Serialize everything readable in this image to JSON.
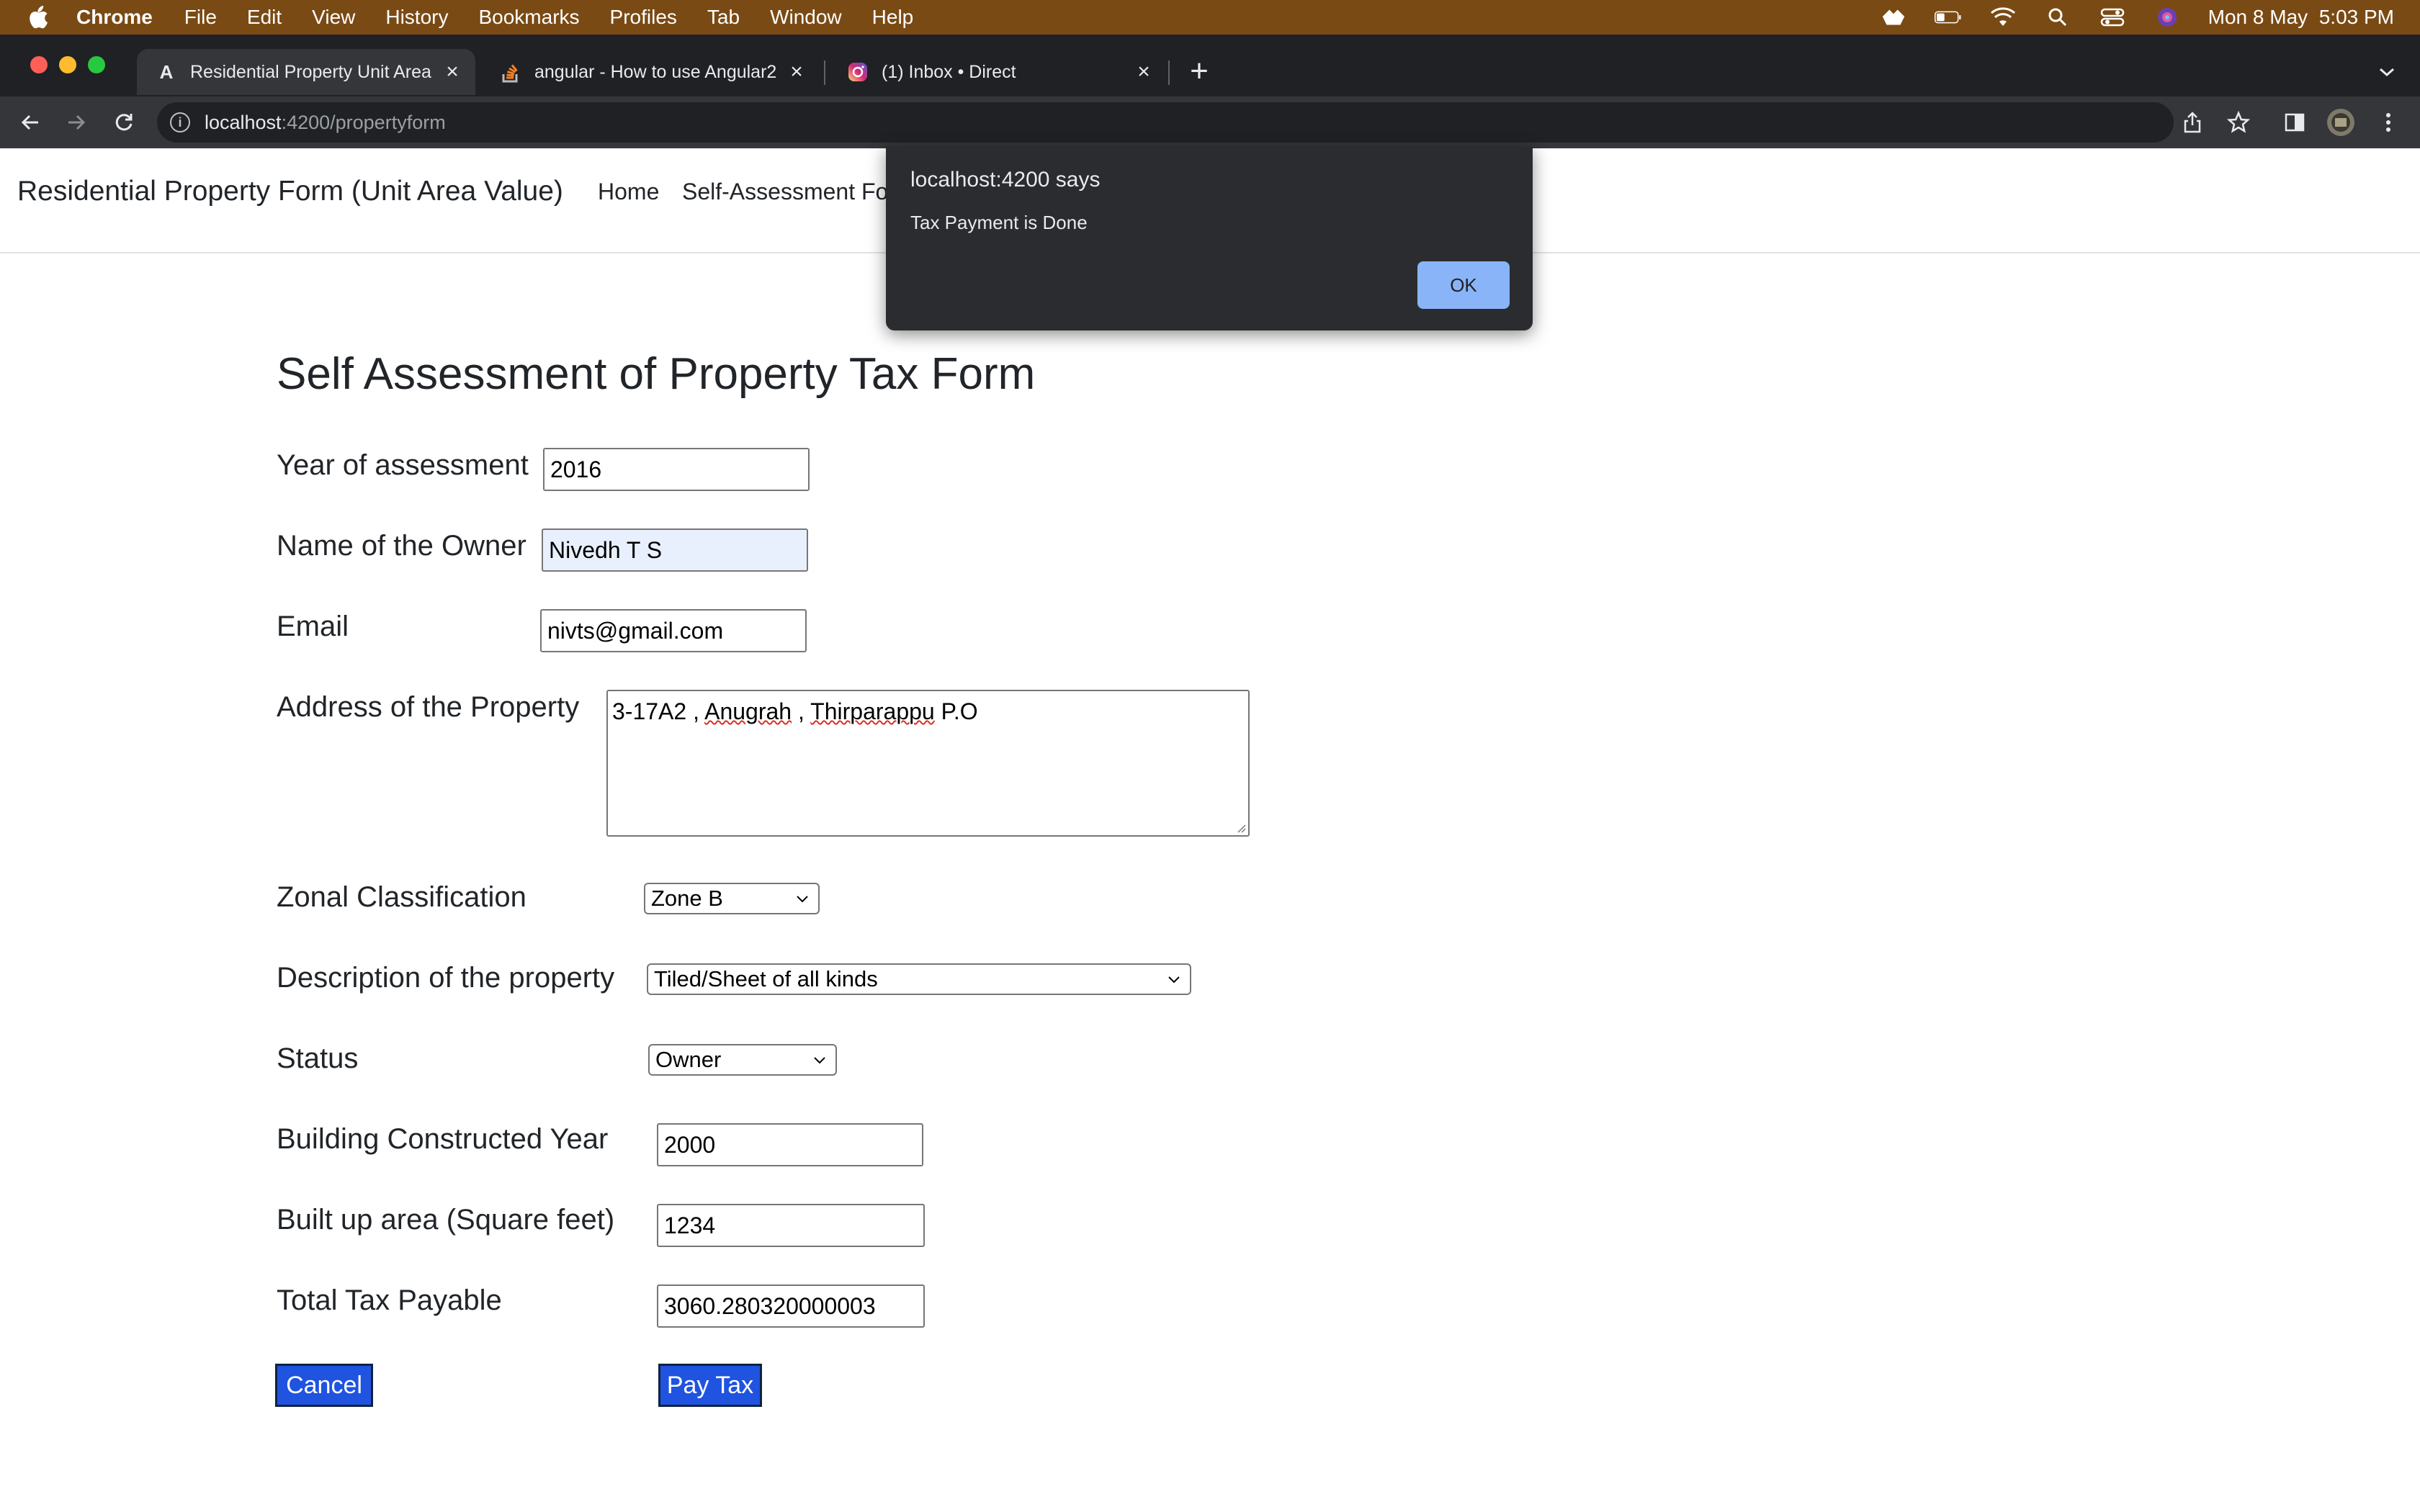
{
  "menubar": {
    "app_name": "Chrome",
    "items": [
      "File",
      "Edit",
      "View",
      "History",
      "Bookmarks",
      "Profiles",
      "Tab",
      "Window",
      "Help"
    ],
    "clock": "Mon 8 May  5:03 PM"
  },
  "tabs": [
    {
      "title": "Residential Property Unit Area",
      "favicon": "A"
    },
    {
      "title": "angular - How to use Angular2",
      "favicon": "stackoverflow-icon"
    },
    {
      "title": "(1) Inbox • Direct",
      "favicon": "instagram-icon"
    }
  ],
  "address_bar": {
    "host": "localhost",
    "path": ":4200/propertyform"
  },
  "navbar": {
    "brand": "Residential Property Form (Unit Area Value)",
    "links": [
      "Home",
      "Self-Assessment Fo"
    ]
  },
  "form": {
    "title": "Self Assessment of Property Tax Form",
    "year_label": "Year of assessment",
    "year_value": "2016",
    "owner_label": "Name of the Owner",
    "owner_value": "Nivedh T S",
    "email_label": "Email",
    "email_value": "nivts@gmail.com",
    "address_label": "Address of the Property",
    "address_parts": [
      "3-17A2 , ",
      "Anugrah",
      " , ",
      "Thirparappu",
      " P.O"
    ],
    "zone_label": "Zonal Classification",
    "zone_value": "Zone B",
    "description_label": "Description of the property",
    "description_value": "Tiled/Sheet of all kinds",
    "status_label": "Status",
    "status_value": "Owner",
    "constructed_label": "Building Constructed Year",
    "constructed_value": "2000",
    "area_label": "Built up area (Square feet)",
    "area_value": "1234",
    "tax_label": "Total Tax Payable",
    "tax_value": "3060.280320000003",
    "cancel_label": "Cancel",
    "pay_label": "Pay Tax"
  },
  "dialog": {
    "title": "localhost:4200 says",
    "message": "Tax Payment is Done",
    "ok_label": "OK"
  },
  "colors": {
    "menubar_bg": "#7a4a14",
    "button_bg": "#1f53e0",
    "dialog_bg": "#2b2c2f",
    "dialog_ok": "#8ab4f8"
  }
}
